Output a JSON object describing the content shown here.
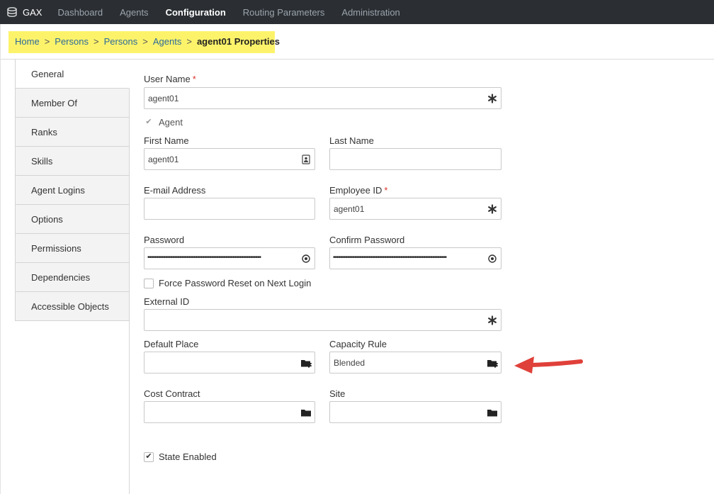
{
  "topnav": {
    "brand": "GAX",
    "items": [
      "Dashboard",
      "Agents",
      "Configuration",
      "Routing Parameters",
      "Administration"
    ],
    "active_index": 2
  },
  "breadcrumb": {
    "items": [
      "Home",
      "Persons",
      "Persons",
      "Agents"
    ],
    "current": "agent01 Properties",
    "separator": ">"
  },
  "sidetabs": [
    "General",
    "Member Of",
    "Ranks",
    "Skills",
    "Agent Logins",
    "Options",
    "Permissions",
    "Dependencies",
    "Accessible Objects"
  ],
  "form": {
    "user_name_label": "User Name",
    "user_name_value": "agent01",
    "agent_label": "Agent",
    "first_name_label": "First Name",
    "first_name_value": "agent01",
    "last_name_label": "Last Name",
    "last_name_value": "",
    "email_label": "E-mail Address",
    "email_value": "",
    "employee_id_label": "Employee ID",
    "employee_id_value": "agent01",
    "password_label": "Password",
    "password_value": "••••••••••••••••••••••••••••••••••••••••••••••••••••••••••••••••",
    "confirm_password_label": "Confirm Password",
    "confirm_password_value": "••••••••••••••••••••••••••••••••••••••••••••••••••••••••••••••••",
    "force_reset_label": "Force Password Reset on Next Login",
    "external_id_label": "External ID",
    "external_id_value": "",
    "default_place_label": "Default Place",
    "default_place_value": "",
    "capacity_rule_label": "Capacity Rule",
    "capacity_rule_value": "Blended",
    "cost_contract_label": "Cost Contract",
    "cost_contract_value": "",
    "site_label": "Site",
    "site_value": "",
    "state_enabled_label": "State Enabled",
    "required_marker": "*"
  },
  "icons": {
    "required": "asterisk-icon",
    "contact": "contact-card-icon",
    "show_password": "eye-icon",
    "browse": "folder-icon",
    "browse_clear": "folder-clear-icon",
    "annotation": "red-arrow-icon"
  },
  "colors": {
    "nav_bg": "#2b2f33",
    "highlight": "#fdf36a",
    "link": "#2c6a9a",
    "required": "#d9352b",
    "arrow": "#e0403a"
  }
}
